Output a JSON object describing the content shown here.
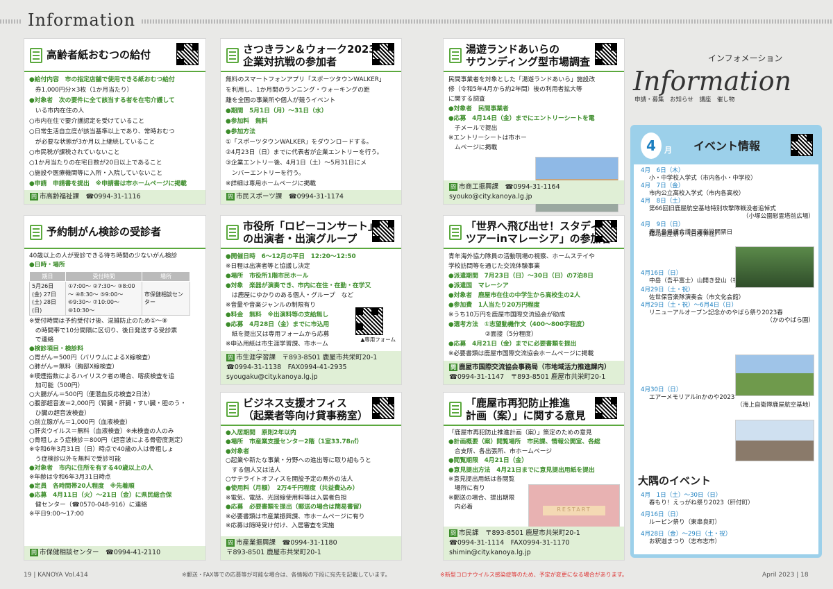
{
  "header": {
    "title": "Information"
  },
  "cards": {
    "c1": {
      "title": "高齢者紙おむつの給付",
      "lines": [
        "●給付内容　市の指定店舗で使用できる紙おむつ給付",
        "　券1,000円分×3枚（1か月当たり）",
        "●対象者　次の要件に全て該当する者を在宅介護して",
        "　いる市内在住の人",
        "○市内在住で要介護認定を受けていること",
        "○日常生活自立度が該当基準以上であり、常時おむつ",
        "　が必要な状態が3か月以上継続していること",
        "○市民税が課税されていないこと",
        "○1か月当たりの在宅日数が20日以上であること",
        "○施設や医療機関等に入所・入院していないこと",
        "●申請　申請書を提出　※申請書は市ホームページに掲載"
      ],
      "footer": "市高齢福祉課　☎0994-31-1116"
    },
    "c2": {
      "title1": "さつきラン＆ウォーク2023",
      "title2": "企業対抗戦の参加者",
      "lines": [
        "無料のスマートフォンアプリ「スポーツタウンWALKER」",
        "を利用し、1か月間のランニング・ウォーキングの距",
        "離を全国の事業所や個人が競うイベント",
        "●期間　5月1日（月）～31日（水）",
        "●参加料　無料",
        "●参加方法",
        "①「スポーツタウンWALKER」をダウンロードする。",
        "②4月23日（日）までに代表者が企業エントリーを行う。",
        "③企業エントリー後、4月1日（土）～5月31日にメ",
        "　ンバーエントリーを行う。",
        "※詳細は専用ホームページに掲載"
      ],
      "footer": "市民スポーツ課　☎0994-31-1174"
    },
    "c3": {
      "title1": "湯遊ランドあいらの",
      "title2": "サウンディング型市場調査",
      "lines": [
        "民間事業者を対象とした「湯遊ランドあいら」施設改",
        "修（令和5年4月から約2年間）後の利用者拡大等",
        "に関する調査",
        "●対象者　民間事業者",
        "●応募　4月14日（金）までにエントリーシートを電",
        "　子メールで提出",
        "※エントリーシートは市ホー",
        "　ムページに掲載"
      ],
      "footer1": "市商工振興課　☎0994-31-1164",
      "footer2": "syouko@city.kanoya.lg.jp"
    },
    "c4": {
      "title": "予約制がん検診の受診者",
      "intro": "40歳以上の人が受診できる待ち時間の少ないがん検診",
      "sched_label": "●日時・場所",
      "th": [
        "期日",
        "受付時間",
        "場所"
      ],
      "date": "5月26日(金) 27日(土) 28日(日)",
      "times": "①7:00～ ②7:30～ ③8:00～ ④8:30～ ⑤9:00～ ⑥9:30～ ⑦10:00～ ⑧10:30～",
      "place": "市保健相談センター",
      "lines": [
        "※受付時間は予約受付け後、混雑防止のため①～⑧",
        "　の時間帯で10分間隔に区切り、後日発送する受診票",
        "　で連絡",
        "●検診項目・検診料",
        "○胃がん＝500円（バリウムによるX線検査）",
        "○肺がん＝無料（胸部X線検査）",
        "※喫煙指数によるハイリスク者の場合、喀痰検査を追",
        "　加可能（500円）",
        "○大腸がん＝500円（便潜血反応検査2日法）",
        "○腹部超音波＝2,000円（腎臓・肝臓・すい臓・胆のう・",
        "　ひ臓の超音波検査）",
        "○前立腺がん＝1,000円（血液検査）",
        "○肝炎ウイルス＝無料（血液検査）※未検査の人のみ",
        "○骨粗しょう症検診＝800円（超音波による骨密度測定）",
        "※令和6年3月31日（日）時点で40歳の人は骨粗しょ",
        "　う症検診以外を無料で受診可能",
        "●対象者　市内に住所を有する40歳以上の人",
        "※年齢は令和6年3月31日時点",
        "●定員　各時間帯20人程度　※先着順",
        "●応募　4月11日（火）～21日（金）に県民総合保",
        "　健センター（☎0570-048-916）に連絡",
        "※平日9:00～17:00"
      ],
      "footer": "市保健相談センター　☎0994-41-2110"
    },
    "c5": {
      "title1": "市役所「ロビーコンサート」",
      "title2": "の出演者・出演グループ",
      "lines": [
        "●開催日時　6～12月の平日　12:20～12:50",
        "※日程は出演者等と協議し決定",
        "●場所　市役所1階市民ホール",
        "●対象　楽器が演奏でき、市内に在住・在勤・在学又",
        "　は鹿屋にゆかりのある個人・グループ　など",
        "※音量や音楽ジャンルの制限有り",
        "●料金　無料　※出演料等の支給無し",
        "●応募　4月28日（金）までに市込用",
        "　紙を提出又は専用フォームから応募",
        "※申込用紙は市生涯学習課、市ホーム",
        "　ページに有り"
      ],
      "form": "▲専用フォーム",
      "footer1": "市生涯学習課　〒893-8501 鹿屋市共栄町20-1",
      "footer2": "☎0994-31-1138　FAX0994-41-2935",
      "footer3": "syougaku@city.kanoya.lg.jp"
    },
    "c6": {
      "title1": "「世界へ飛び出せ！スタディ",
      "title2": "ツアーinマレーシア」の参加者",
      "lines": [
        "青年海外協力隊員の活動現場の視察、ホームステイや",
        "学校訪問等を通じた交流体験事業",
        "●派遣期間　7月23日（日）～30日（日）の7泊8日",
        "●派遣国　マレーシア",
        "●対象者　鹿屋市在住の中学生から高校生の2人",
        "●参加費　1人当たり20万円程度",
        "※うち10万円を鹿屋市国際交流協会が助成",
        "●選考方法　①志望動機作文（400～800字程度）",
        "　　　　　　②面接（5分程度）",
        "●応募　4月21日（金）までに必要書類を提出",
        "※必要書類は鹿屋市国際交流協会ホームページに掲載"
      ],
      "footer1": "鹿屋市国際交流協会事務局（市地域活力推進課内）",
      "footer2": "☎0994-31-1147　〒893-8501 鹿屋市共栄町20-1"
    },
    "c7": {
      "title1": "ビジネス支援オフィス",
      "title2": "（起業者等向け貸事務室）",
      "lines": [
        "●入居期間　原則2年以内",
        "●場所　市産業支援センター2階（1室33.78㎡）",
        "●対象者",
        "○起業や新たな事業・分野への進出等に取り組もうと",
        "　する個人又は法人",
        "○サテライトオフィスを開設予定の県外の法人",
        "●使用料（月額）　2万4千円程度（共益費込み）",
        "※電気、電話、光回線使用料等は入居者負担",
        "●応募　必要書類を提出（郵送の場合は簡易書留）",
        "※必要書類は市産業振興課、市ホームページに有り",
        "※応募は随時受け付け、入居審査を実施"
      ],
      "footer1": "市産業振興課　☎0994-31-1180",
      "footer2": "〒893-8501 鹿屋市共栄町20-1"
    },
    "c8": {
      "title1": "「鹿屋市再犯防止推進",
      "title2": "計画（案）」に関する意見",
      "lines": [
        "「鹿屋市再犯防止推進計画（案）」策定のための意見",
        "●計画概要（案）閲覧場所　市民課、情報公開室、各総",
        "　合支所、各出張所、市ホームページ",
        "●閲覧期限　4月21日（金）",
        "●意見提出方法　4月21日までに意見提出用紙を提出",
        "※意見提出用紙は各閲覧",
        "　場所に有り",
        "※郵送の場合、提出期限",
        "　内必着"
      ],
      "photo_text": "RESTART",
      "footer1": "市民課　〒893-8501 鹿屋市共栄町20-1",
      "footer2": "☎0994-31-1114　FAX0994-31-1170",
      "footer3": "shimin@city.kanoya.lg.jp"
    }
  },
  "side": {
    "logo_kana": "インフォメーション",
    "logo": "Information",
    "cats": "申請・募集　お知らせ　講座　催し物",
    "month": "4",
    "month_label": "月",
    "heading": "イベント情報",
    "events": [
      {
        "d": "4月　6日（木）",
        "v": "小・中学校入学式（市内各小・中学校）",
        "r": ""
      },
      {
        "d": "4月　7日（金）",
        "v": "市内公立高校入学式（市内各高校）",
        "r": ""
      },
      {
        "d": "4月　8日（土）",
        "v": "第66回旧鹿屋航空基地特別攻撃隊戦没者追悼式",
        "r": "（小塚公園慰霊塔前広場）"
      },
      {
        "d": "4月　9日（日）",
        "v": "鹿児島県議会議員選挙投開票日",
        "r": ""
      },
      {
        "d": "",
        "v": "輝北畜産祭り（日枝神社）",
        "r": ""
      },
      {
        "d": "4月16日（日）",
        "v": "中岳（吾平富士）山開き登山（神野中岳）",
        "r": ""
      },
      {
        "d": "4月29日（土・祝）",
        "v": "佐世保音楽隊演奏会（市文化会館）",
        "r": ""
      },
      {
        "d": "4月29日（土・祝）～6月4日（日）",
        "v": "リニューアルオープン記念かのやばら祭り2023春",
        "r": "（かのやばら園）"
      },
      {
        "d": "4月30日（日）",
        "v": "エアーメモリアルinかのや2023",
        "r": "（海上自衛隊鹿屋航空基地）"
      }
    ],
    "osumi_title": "大隅のイベント",
    "osumi": [
      {
        "d": "4月　1日（土）～30日（日）",
        "v": "春もり！えっがね祭り2023（肝付町）"
      },
      {
        "d": "4月16日（日）",
        "v": "ルーピン祭り（東串良町）"
      },
      {
        "d": "4月28日（金）～29日（土・祝）",
        "v": "お釈迦まつり（志布志市）"
      }
    ]
  },
  "footer": {
    "left": "19 | KANOYA Vol.414",
    "note1": "※郵送・FAX等での応募等が可能な場合は、各情報の下段に宛先を記載しています。",
    "note2": "※新型コロナウイルス感染症等のため、予定が変更になる場合があります。",
    "right": "April 2023 | 18"
  }
}
